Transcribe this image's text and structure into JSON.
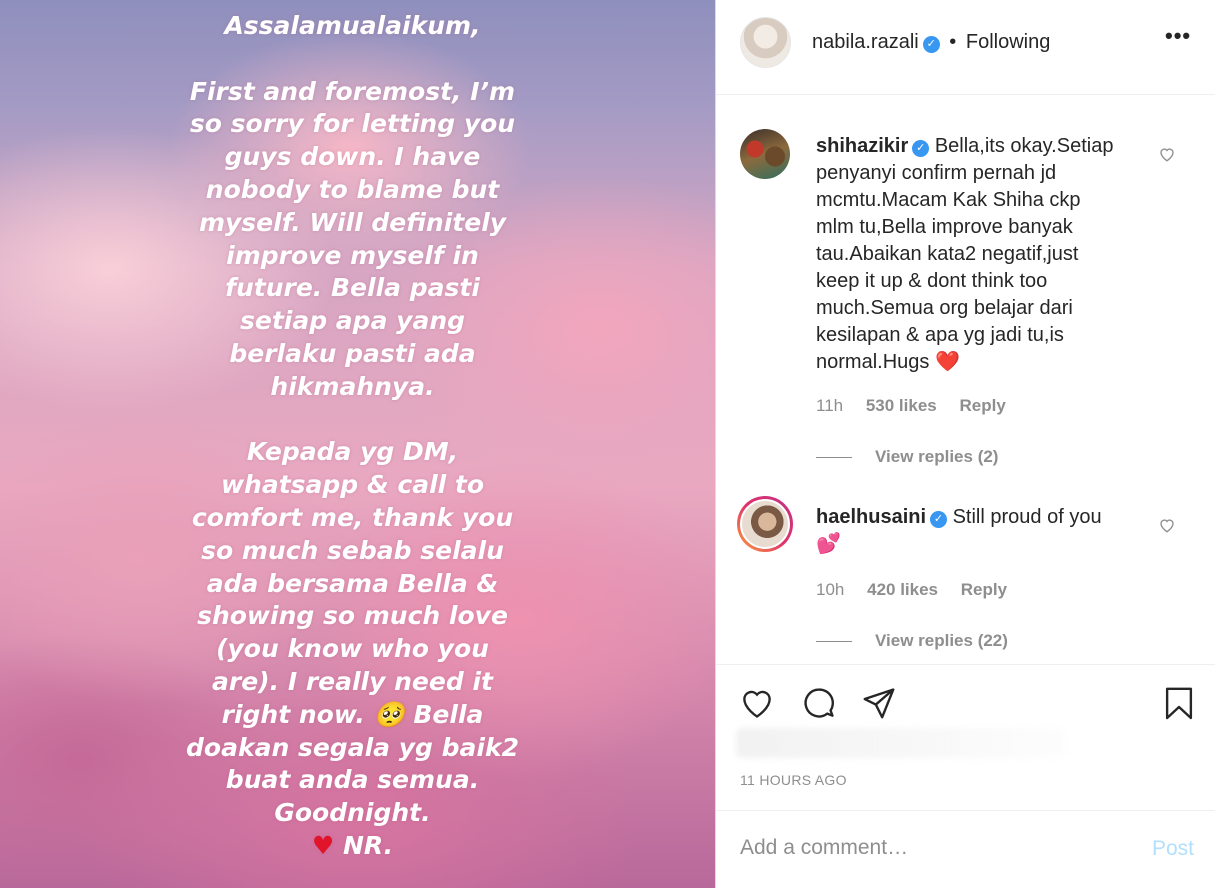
{
  "story": {
    "greeting": "Assalamualaikum,",
    "paragraph1": "First and foremost, I’m\nso sorry for letting you\nguys down. I have\nnobody to blame but\nmyself. Will definitely\nimprove myself in\nfuture. Bella pasti\nsetiap apa yang\nberlaku pasti ada\nhikmahnya.",
    "paragraph2": "Kepada yg DM,\nwhatsapp & call to\ncomfort me, thank you\nso much sebab selalu\nada bersama Bella &\nshowing so much love\n(you know who you\nare). I really need it\nright now. 🥺 Bella\ndoakan segala yg baik2\nbuat anda semua.\nGoodnight.",
    "signoff_heart": "♥",
    "signoff": " NR."
  },
  "header": {
    "username": "nabila.razali",
    "verified_glyph": "✓",
    "separator": "•",
    "follow_status": "Following",
    "more_glyph": "•••"
  },
  "comments": [
    {
      "username": "shihazikir",
      "text": "Bella,its okay.Setiap penyanyi confirm pernah jd mcmtu.Macam Kak Shiha ckp mlm tu,Bella improve banyak tau.Abaikan kata2 negatif,just keep it up & dont think too much.Semua org belajar dari kesilapan & apa yg jadi tu,is normal.Hugs",
      "emoji": "❤️",
      "time": "11h",
      "likes": "530 likes",
      "reply_label": "Reply",
      "view_replies": "View replies (2)"
    },
    {
      "username": "haelhusaini",
      "text": "Still proud of you",
      "emoji": "💕",
      "time": "10h",
      "likes": "420 likes",
      "reply_label": "Reply",
      "view_replies": "View replies (22)"
    }
  ],
  "timestamp": "11 HOURS AGO",
  "add_comment": {
    "placeholder": "Add a comment…",
    "post_label": "Post"
  },
  "colors": {
    "verified": "#3897f0",
    "post_button": "#b2dffc",
    "meta_text": "#8e8e8e"
  }
}
